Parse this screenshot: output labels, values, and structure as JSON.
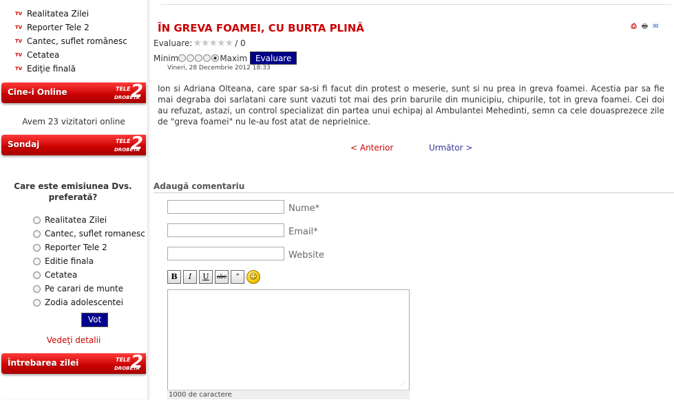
{
  "sidebar": {
    "menu": [
      {
        "label": "Realitatea Zilei"
      },
      {
        "label": "Reporter Tele 2"
      },
      {
        "label": "Cantec, suflet românesc"
      },
      {
        "label": "Cetatea"
      },
      {
        "label": "Ediţie finală"
      }
    ],
    "icon_text": "TV",
    "logo": {
      "small": "TELE",
      "number": "2",
      "sub": "DROBETA"
    },
    "online_title": "Cine-i Online",
    "online_text": "Avem 23 vizitatori online",
    "poll_title": "Sondaj",
    "poll_question": "Care este emisiunea Dvs. preferată?",
    "poll_options": [
      {
        "label": "Realitatea Zilei"
      },
      {
        "label": "Cantec, suflet romanesc"
      },
      {
        "label": "Reporter Tele 2"
      },
      {
        "label": "Editie finala"
      },
      {
        "label": "Cetatea"
      },
      {
        "label": "Pe carari de munte"
      },
      {
        "label": "Zodia adolescentei"
      }
    ],
    "vote_label": "Vot",
    "details_label": "Vedeţi detalii",
    "question_title": "Întrebarea zilei"
  },
  "article": {
    "title": "ÎN GREVA FOAMEI, CU BURTA PLINĂ",
    "rating_label": "Evaluare:",
    "stars": "★★★★★",
    "rating_value": "/ 0",
    "min_label": "Minim",
    "max_label": "Maxim",
    "eval_button": "Evaluare",
    "date": "Vineri, 28 Decembrie 2012 18:33",
    "body": "Ion si Adriana Olteana, care spar sa-si fi facut din protest o meserie, sunt si nu prea in greva foamei. Acestia par sa fie mai degraba doi sarlatani care sunt vazuti tot mai des prin barurile din municipiu, chipurile, tot in greva foamei. Cei doi au refuzat, astazi, un control specializat din partea unui echipaj al Ambulantei Mehedinti, semn ca cele douasprezece zile de \"greva foamei\" nu le-au fost atat de neprielnice.",
    "prev_label": "< Anterior",
    "next_label": "Următor >",
    "icons": {
      "pdf": "pdf-icon",
      "print": "print-icon",
      "email": "email-icon"
    }
  },
  "comments": {
    "title": "Adaugă comentariu",
    "name_label": "Nume*",
    "email_label": "Email*",
    "website_label": "Website",
    "toolbar": {
      "bold": "B",
      "italic": "I",
      "underline": "U",
      "strike": "abc",
      "quote": "”",
      "smiley": "☺"
    },
    "counter": "1000 de caractere"
  }
}
